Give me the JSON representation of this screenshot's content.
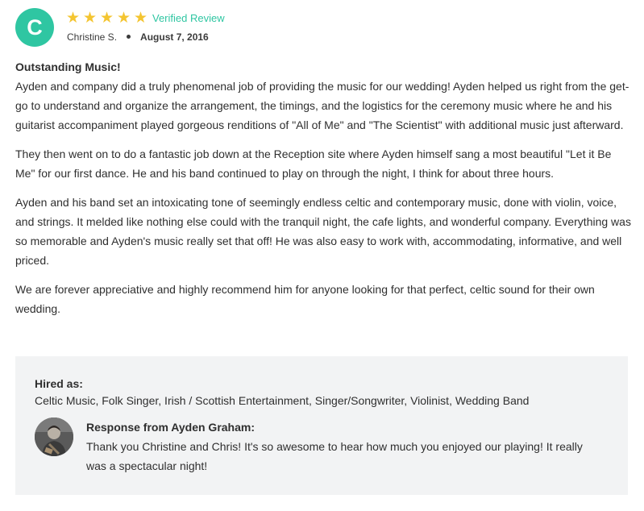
{
  "accent_color": "#2fc6a2",
  "star_color": "#f4c531",
  "reviewer": {
    "initial": "C",
    "name": "Christine S.",
    "date": "August 7, 2016",
    "rating": 5,
    "verified_label": "Verified Review"
  },
  "review": {
    "title": "Outstanding Music!",
    "paragraphs": [
      "Ayden and company did a truly phenomenal job of providing the music for our wedding! Ayden helped us right from the get-go to understand and organize the arrangement, the timings, and the logistics for the ceremony music where he and his guitarist accompaniment played gorgeous renditions of \"All of Me\" and \"The Scientist\" with additional music just afterward.",
      "They then went on to do a fantastic job down at the Reception site where Ayden himself sang a most beautiful \"Let it Be Me\" for our first dance. He and his band continued to play on through the night, I think for about three hours.",
      "Ayden and his band set an intoxicating tone of seemingly endless celtic and contemporary music, done with violin, voice, and strings. It melded like nothing else could with the tranquil night, the cafe lights, and wonderful company. Everything was so memorable and Ayden's music really set that off! He was also easy to work with, accommodating, informative, and well priced.",
      "We are forever appreciative and highly recommend him for anyone looking for that perfect, celtic sound for their own wedding."
    ]
  },
  "hired": {
    "label": "Hired as:",
    "categories": "Celtic Music, Folk Singer, Irish / Scottish Entertainment, Singer/Songwriter, Violinist, Wedding Band"
  },
  "response": {
    "title": "Response from Ayden Graham:",
    "text": "Thank you Christine and Chris! It's so awesome to hear how much you enjoyed our playing! It really was a spectacular night!"
  }
}
